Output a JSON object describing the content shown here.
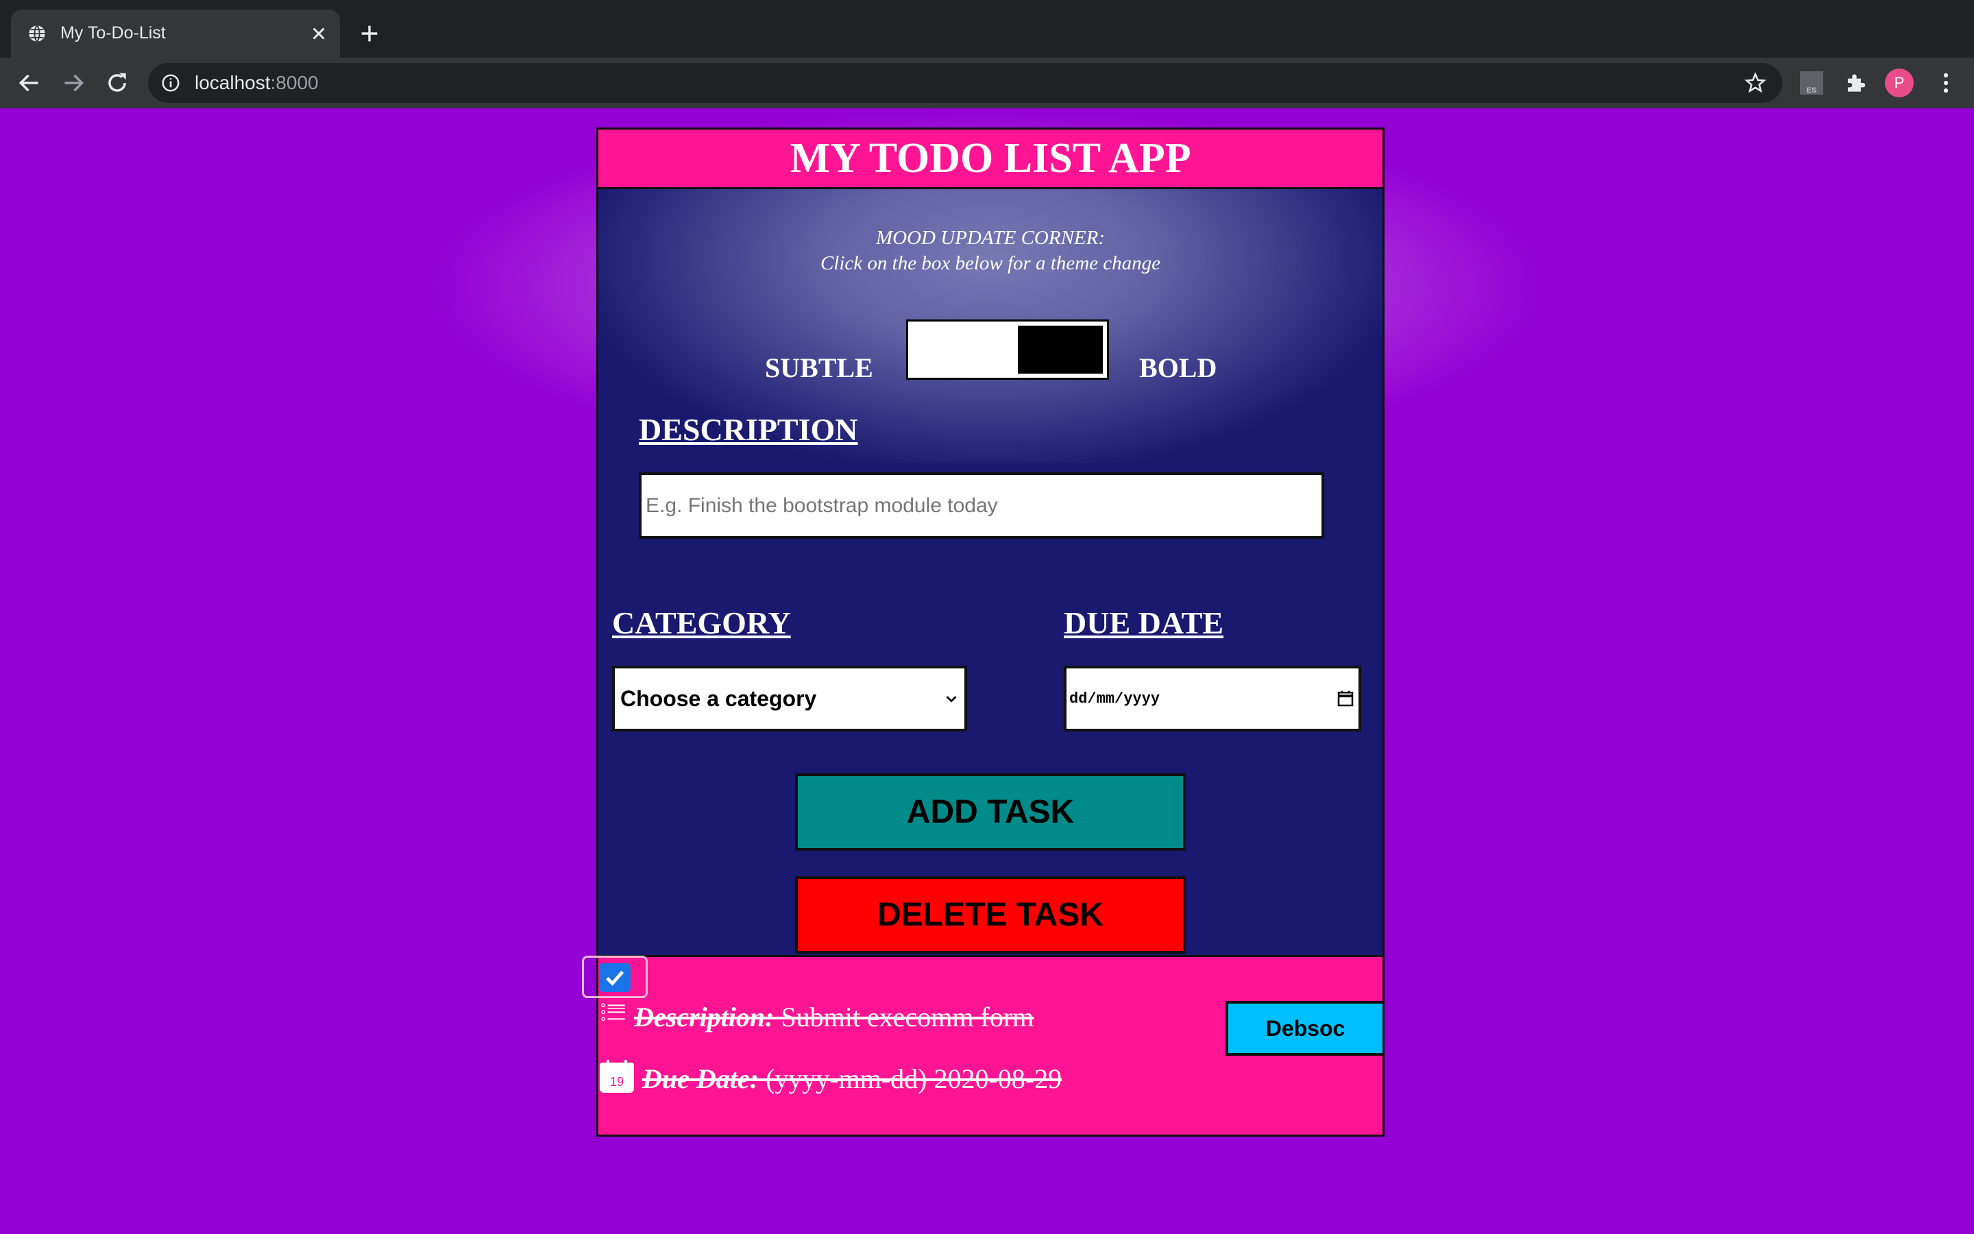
{
  "browser": {
    "tab_title": "My To-Do-List",
    "url_host": "localhost",
    "url_port": ":8000",
    "avatar_initial": "P",
    "extension_label": "ES",
    "icons": [
      "globe-icon",
      "close-icon",
      "plus-icon",
      "back-icon",
      "forward-icon",
      "reload-icon",
      "info-icon",
      "star-icon",
      "puzzle-icon",
      "kebab-menu-icon"
    ]
  },
  "app": {
    "title": "MY TODO LIST APP",
    "mood": {
      "line1": "MOOD UPDATE CORNER:",
      "line2": "Click on the box below for a theme change"
    },
    "theme_toggle": {
      "left_label": "SUBTLE",
      "right_label": "BOLD",
      "state": "bold"
    },
    "description": {
      "heading": "DESCRIPTION",
      "placeholder": "E.g. Finish the bootstrap module today",
      "value": ""
    },
    "category": {
      "heading": "CATEGORY",
      "selected": "Choose a category"
    },
    "due_date": {
      "heading": "DUE DATE",
      "placeholder": "dd/mm/yyyy"
    },
    "buttons": {
      "add": "ADD TASK",
      "delete": "DELETE TASK"
    },
    "tasks": [
      {
        "checked": true,
        "description_label": "Description:",
        "description_value": "Submit execomm form",
        "due_label": "Due Date:",
        "due_value": "(yyyy-mm-dd) 2020-08-29",
        "category": "Debsoc",
        "calendar_day": "19"
      }
    ]
  },
  "colors": {
    "page_bg": "#9400d3",
    "header_bg": "#ff1493",
    "panel_bg": "#191970",
    "add_button": "#008b8b",
    "delete_button": "#ff0000",
    "task_bg": "#ff1493",
    "category_badge": "#00bfff",
    "checkbox": "#1a73e8"
  }
}
